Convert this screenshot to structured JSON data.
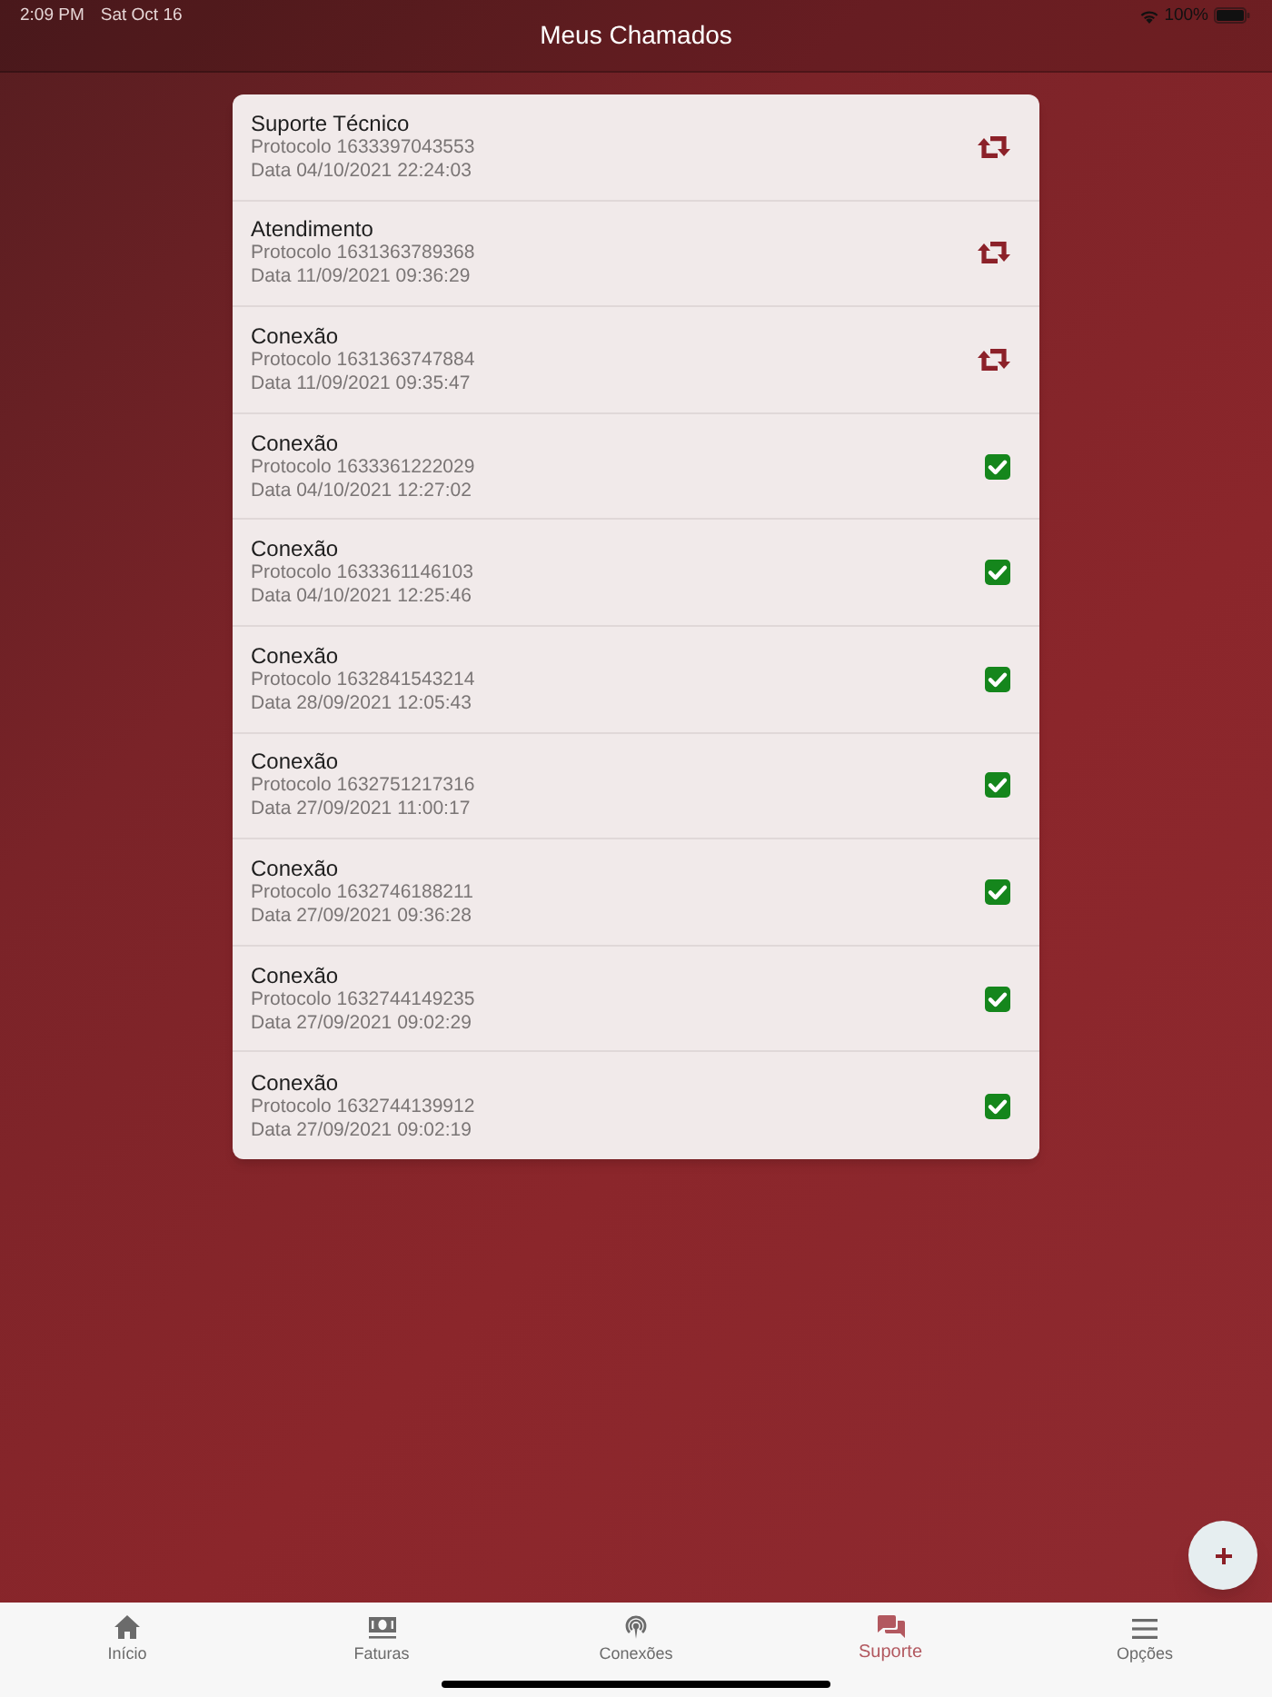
{
  "status_bar": {
    "time": "2:09 PM",
    "date": "Sat Oct 16",
    "battery": "100%"
  },
  "header": {
    "title": "Meus Chamados"
  },
  "tickets": [
    {
      "title": "Suporte Técnico",
      "protocol": "Protocolo 1633397043553",
      "date": "Data 04/10/2021 22:24:03",
      "kind": "reopen"
    },
    {
      "title": "Atendimento",
      "protocol": "Protocolo 1631363789368",
      "date": "Data 11/09/2021 09:36:29",
      "kind": "reopen"
    },
    {
      "title": "Conexão",
      "protocol": "Protocolo 1631363747884",
      "date": "Data 11/09/2021 09:35:47",
      "kind": "reopen"
    },
    {
      "title": "Conexão",
      "protocol": "Protocolo 1633361222029",
      "date": "Data 04/10/2021 12:27:02",
      "kind": "done"
    },
    {
      "title": "Conexão",
      "protocol": "Protocolo 1633361146103",
      "date": "Data 04/10/2021 12:25:46",
      "kind": "done"
    },
    {
      "title": "Conexão",
      "protocol": "Protocolo 1632841543214",
      "date": "Data 28/09/2021 12:05:43",
      "kind": "done"
    },
    {
      "title": "Conexão",
      "protocol": "Protocolo 1632751217316",
      "date": "Data 27/09/2021 11:00:17",
      "kind": "done"
    },
    {
      "title": "Conexão",
      "protocol": "Protocolo 1632746188211",
      "date": "Data 27/09/2021 09:36:28",
      "kind": "done"
    },
    {
      "title": "Conexão",
      "protocol": "Protocolo 1632744149235",
      "date": "Data 27/09/2021 09:02:29",
      "kind": "done"
    },
    {
      "title": "Conexão",
      "protocol": "Protocolo 1632744139912",
      "date": "Data 27/09/2021 09:02:19",
      "kind": "done"
    }
  ],
  "tab_bar": [
    {
      "label": "Início",
      "kind": "home",
      "selected": false
    },
    {
      "label": "Faturas",
      "kind": "money",
      "selected": false
    },
    {
      "label": "Conexões",
      "kind": "signal",
      "selected": false
    },
    {
      "label": "Suporte",
      "kind": "chat",
      "selected": true
    },
    {
      "label": "Opções",
      "kind": "menu",
      "selected": false
    }
  ]
}
